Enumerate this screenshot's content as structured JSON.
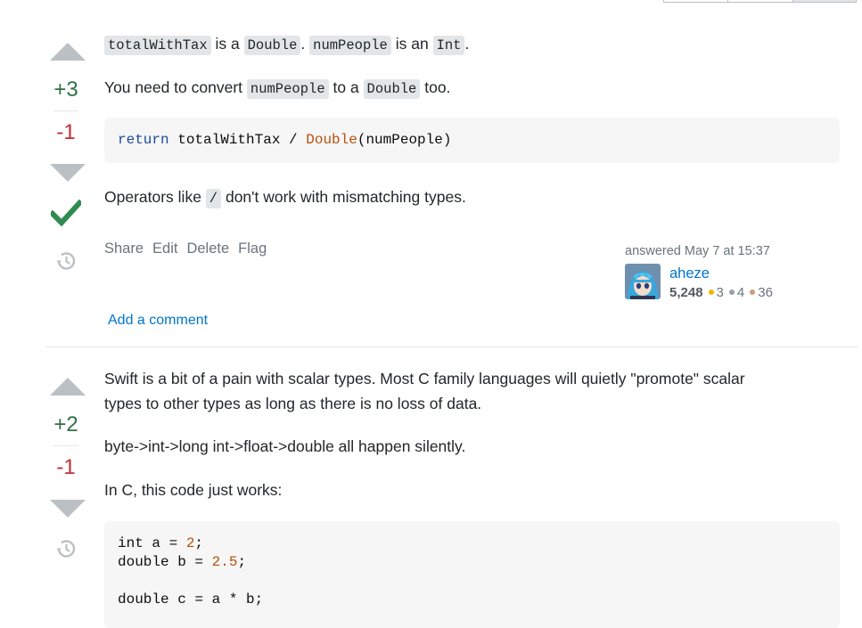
{
  "answer1": {
    "vote_up": "+3",
    "vote_down": "-1",
    "accepted": true,
    "para1": {
      "code_a": "totalWithTax",
      "text_a": " is a ",
      "code_b": "Double",
      "text_b": ". ",
      "code_c": "numPeople",
      "text_c": " is an ",
      "code_d": "Int",
      "text_d": "."
    },
    "para2": {
      "text_a": "You need to convert ",
      "code_a": "numPeople",
      "text_b": " to a ",
      "code_b": "Double",
      "text_c": " too."
    },
    "code_block": {
      "kw": "return",
      "expr_a": " totalWithTax / ",
      "type": "Double",
      "expr_b": "(numPeople)"
    },
    "para3": {
      "text_a": "Operators like ",
      "code_a": "/",
      "text_b": " don't work with mismatching types."
    },
    "menu": {
      "share": "Share",
      "edit": "Edit",
      "delete": "Delete",
      "flag": "Flag"
    },
    "user": {
      "answered": "answered May 7 at 15:37",
      "name": "aheze",
      "reputation": "5,248",
      "gold": "3",
      "silver": "4",
      "bronze": "36"
    },
    "add_comment": "Add a comment"
  },
  "answer2": {
    "vote_up": "+2",
    "vote_down": "-1",
    "para1_line1": "Swift is a bit of a pain with scalar types. Most C family languages will quietly \"promote\" scalar",
    "para1_line2": "types to other types as long as there is no loss of data.",
    "para2": "byte->int->long int->float->double all happen silently.",
    "para3": "In C, this code just works:",
    "code": {
      "l1_a": "int a = ",
      "l1_num": "2",
      "l1_b": ";",
      "l2_a": "double b = ",
      "l2_num": "2.5",
      "l2_b": ";",
      "l4": "double c = a * b;"
    }
  },
  "colors": {
    "gold": "#f1b600",
    "silver": "#9a9fa5",
    "bronze": "#ce9b78",
    "accent": "#0074cc",
    "check": "#2f8a50"
  }
}
